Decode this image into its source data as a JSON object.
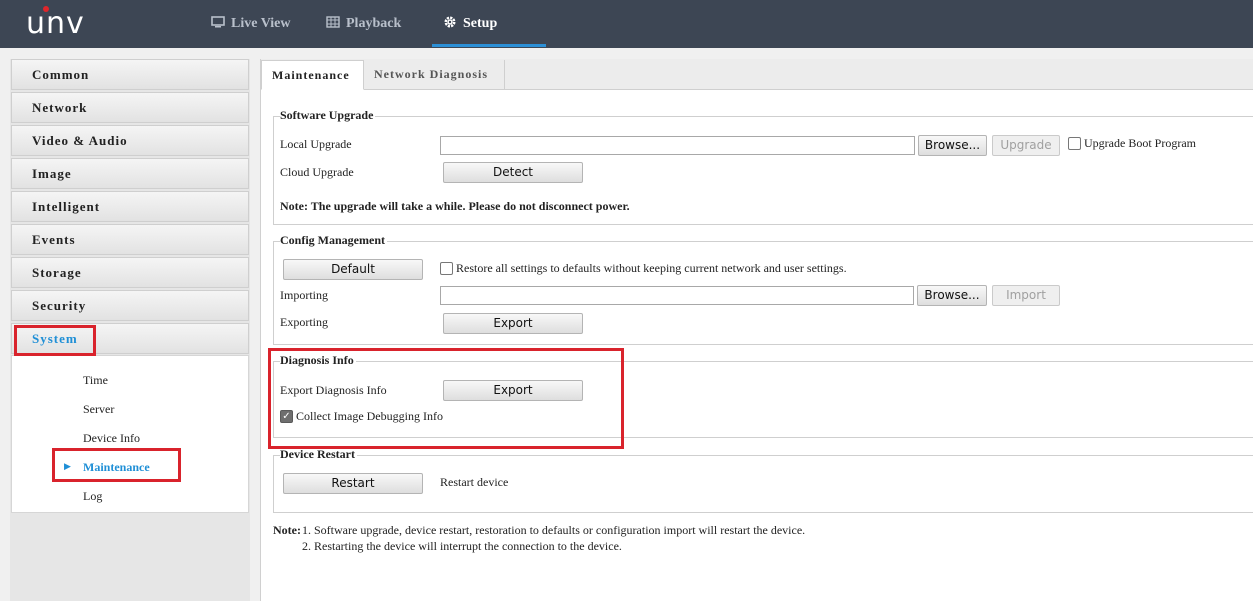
{
  "brand": {
    "logo": "unv"
  },
  "nav": [
    {
      "label": "Live View",
      "icon": "monitor-icon"
    },
    {
      "label": "Playback",
      "icon": "film-icon"
    },
    {
      "label": "Setup",
      "icon": "gear-icon"
    }
  ],
  "sidebar": {
    "items": [
      {
        "label": "Common"
      },
      {
        "label": "Network"
      },
      {
        "label": "Video & Audio"
      },
      {
        "label": "Image"
      },
      {
        "label": "Intelligent"
      },
      {
        "label": "Events"
      },
      {
        "label": "Storage"
      },
      {
        "label": "Security"
      },
      {
        "label": "System"
      }
    ],
    "subitems": [
      {
        "label": "Time"
      },
      {
        "label": "Server"
      },
      {
        "label": "Device Info"
      },
      {
        "label": "Maintenance"
      },
      {
        "label": "Log"
      }
    ]
  },
  "tabs": [
    {
      "label": "Maintenance"
    },
    {
      "label": "Network Diagnosis"
    }
  ],
  "software_upgrade": {
    "title": "Software Upgrade",
    "local_upgrade_label": "Local Upgrade",
    "local_upgrade_value": "",
    "browse_label": "Browse...",
    "upgrade_label": "Upgrade",
    "boot_program_label": "Upgrade Boot Program",
    "cloud_upgrade_label": "Cloud Upgrade",
    "detect_label": "Detect",
    "note": "Note: The upgrade will take a while. Please do not disconnect power."
  },
  "config_management": {
    "title": "Config Management",
    "default_label": "Default",
    "restore_label": "Restore all settings to defaults without keeping current network and user settings.",
    "importing_label": "Importing",
    "importing_value": "",
    "browse_label": "Browse...",
    "import_label": "Import",
    "exporting_label": "Exporting",
    "export_label": "Export"
  },
  "diagnosis_info": {
    "title": "Diagnosis Info",
    "export_diag_label": "Export Diagnosis Info",
    "export_label": "Export",
    "collect_label": "Collect Image Debugging Info",
    "collect_checked": true
  },
  "device_restart": {
    "title": "Device Restart",
    "restart_label": "Restart",
    "restart_desc": "Restart device"
  },
  "footer_note": {
    "prefix": "Note:",
    "line1": "1. Software upgrade, device restart, restoration to defaults or configuration import will restart the device.",
    "line2": "2. Restarting the device will interrupt the connection to the device."
  },
  "colors": {
    "accent": "#1f8fd6",
    "highlight": "#d9232c",
    "topbar": "#3d4654"
  }
}
